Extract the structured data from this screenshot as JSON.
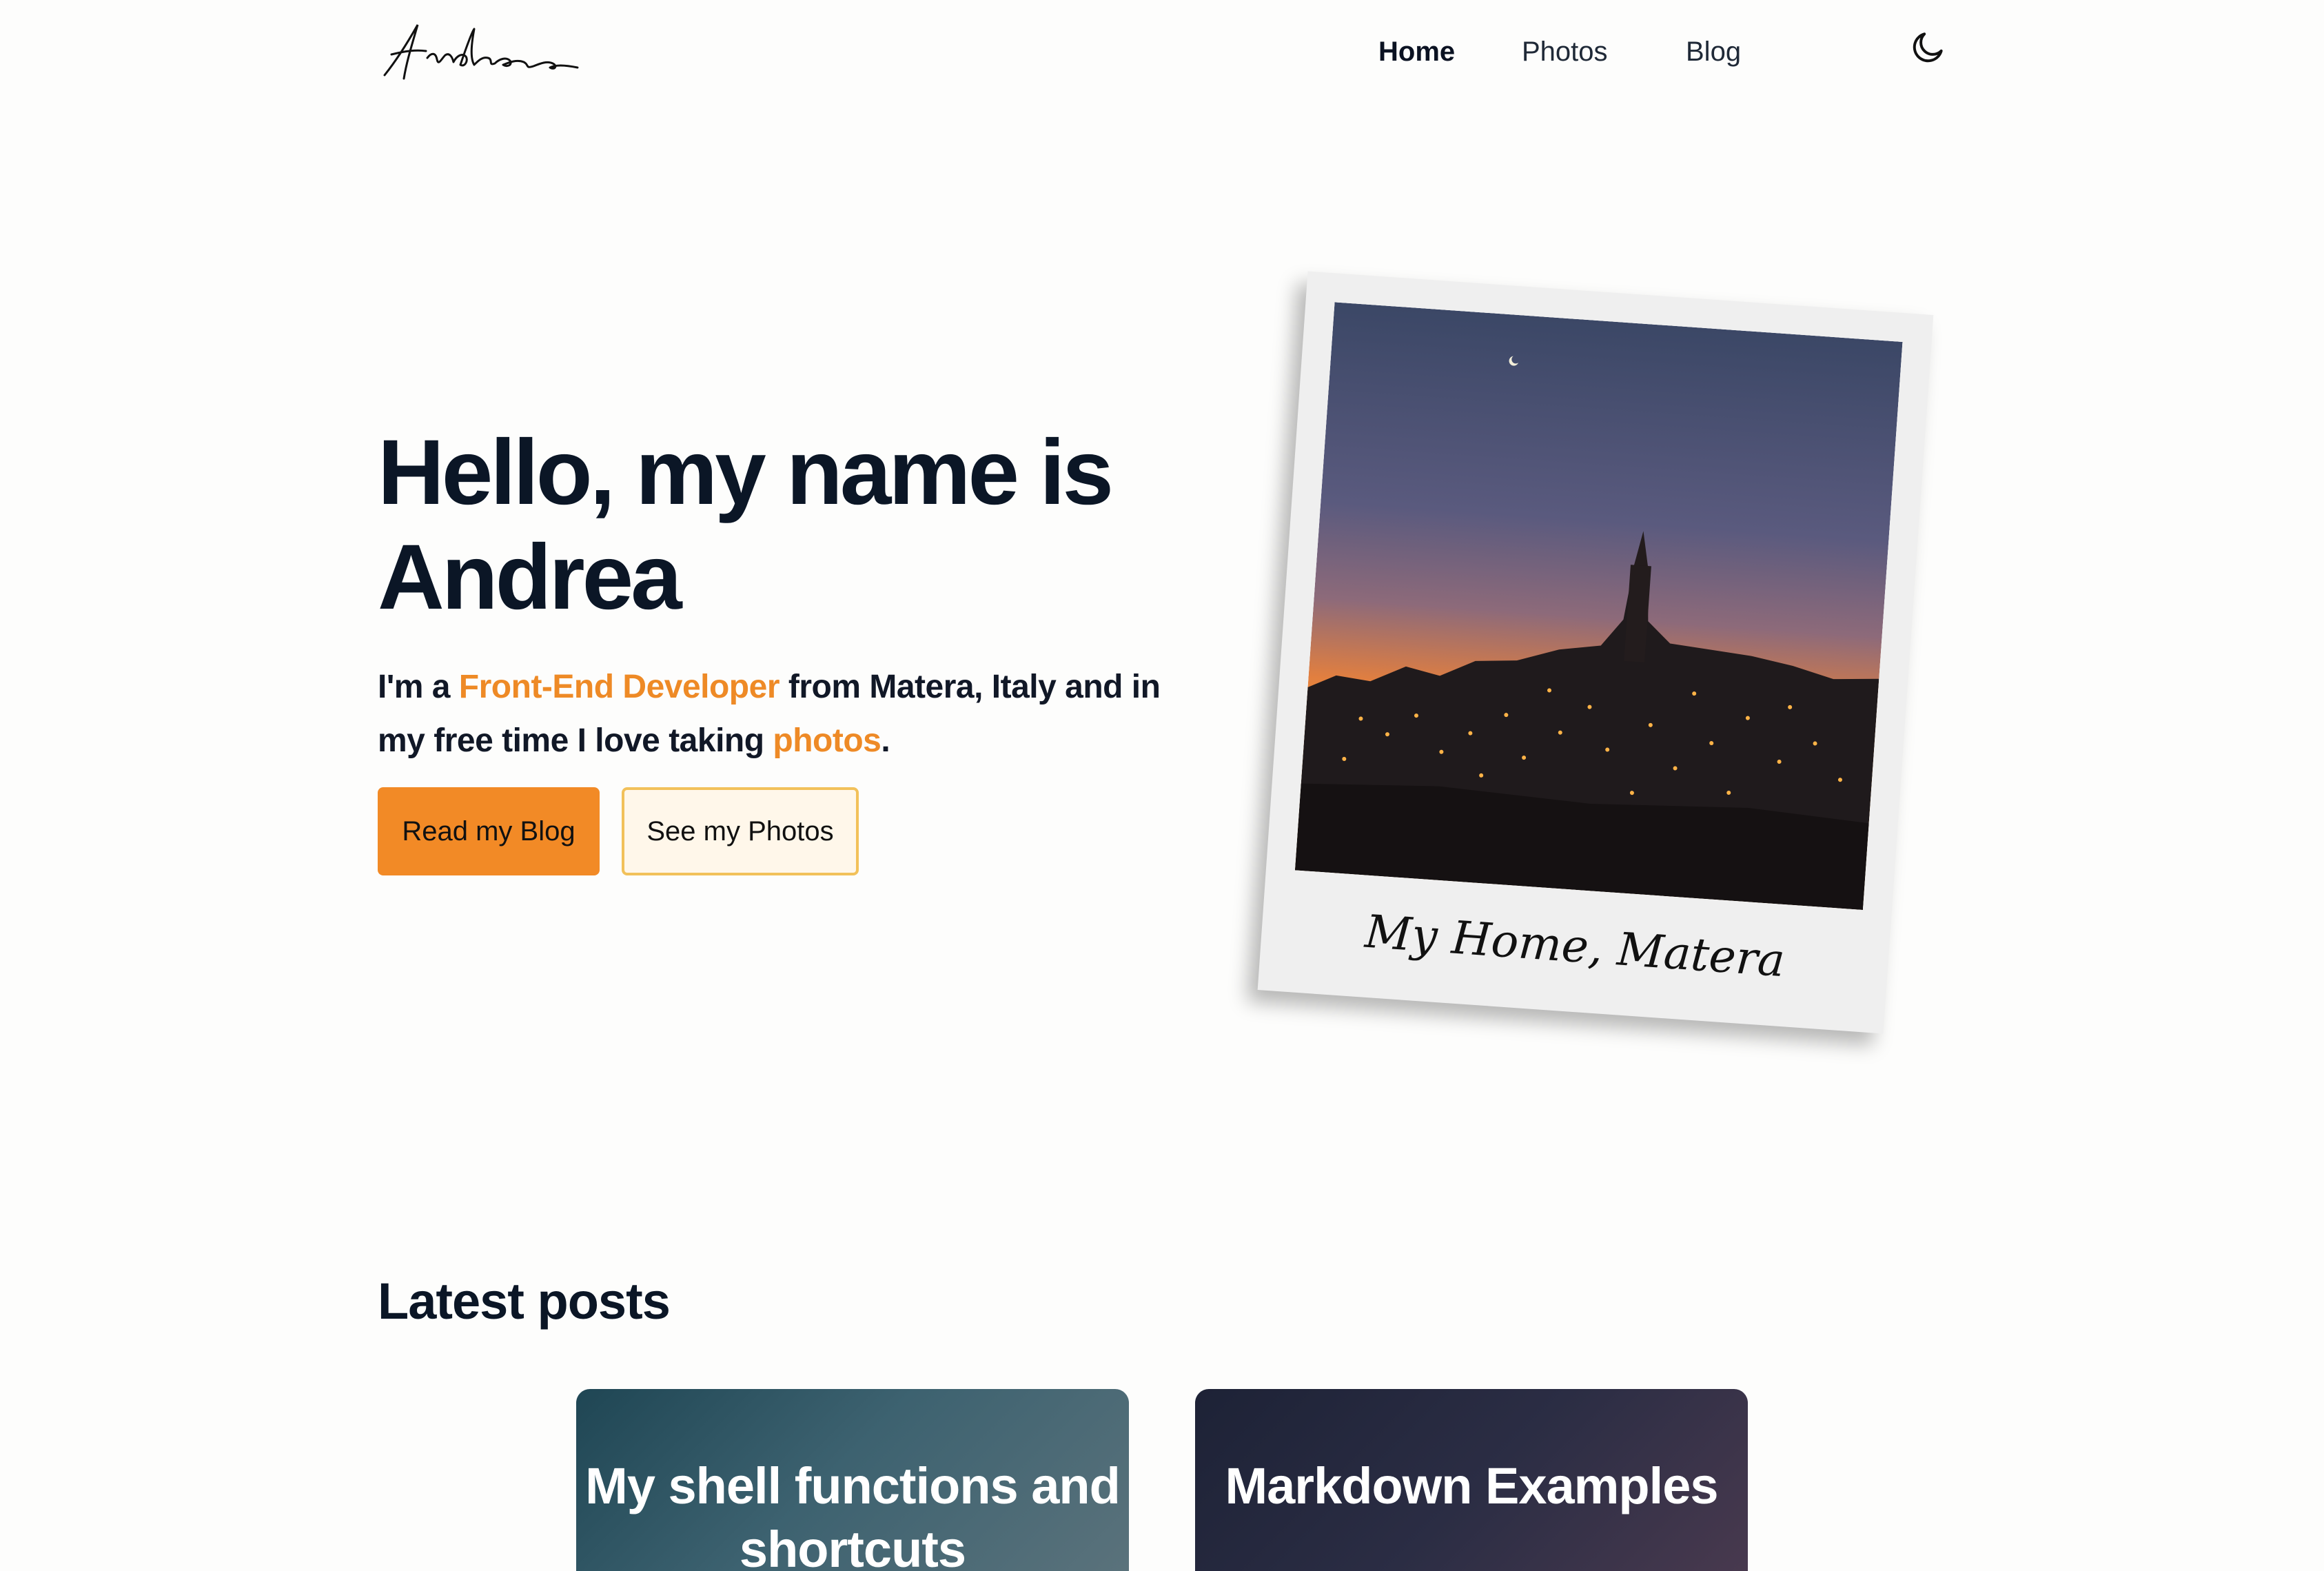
{
  "header": {
    "logo_text": "Andrea",
    "nav": [
      {
        "label": "Home",
        "active": true
      },
      {
        "label": "Photos",
        "active": false
      },
      {
        "label": "Blog",
        "active": false
      }
    ],
    "theme_icon": "moon-icon"
  },
  "hero": {
    "title": "Hello, my name is Andrea",
    "text_prefix": "I'm a ",
    "role": "Front-End Developer",
    "text_middle": " from Matera, Italy and in my free time I love taking ",
    "hobby": "photos",
    "text_suffix": ".",
    "primary_button": "Read my Blog",
    "secondary_button": "See my Photos",
    "accent_color": "#ee8a26"
  },
  "polaroid": {
    "caption": "My Home, Matera"
  },
  "posts": {
    "title": "Latest posts",
    "items": [
      {
        "title": "My shell functions and shortcuts"
      },
      {
        "title": "Markdown Examples"
      }
    ]
  }
}
